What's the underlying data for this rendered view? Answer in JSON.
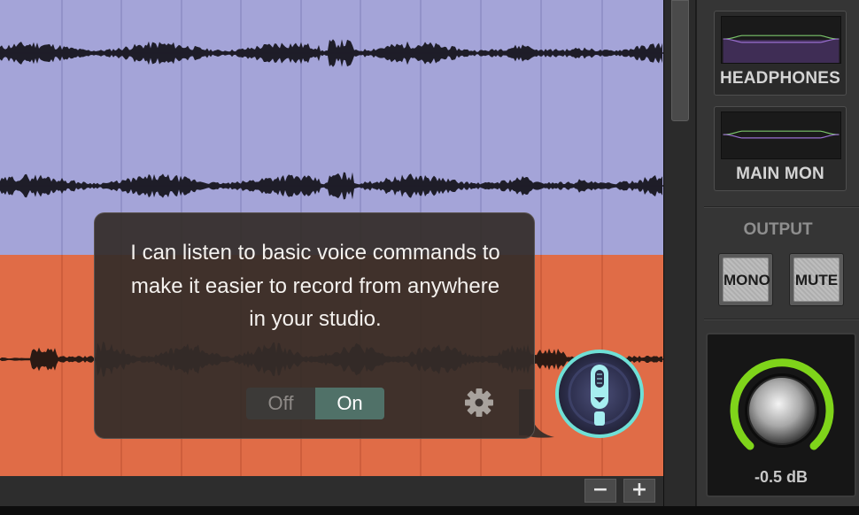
{
  "voice_tooltip": {
    "message": "I can listen to basic voice commands to make it easier to record from anywhere in your studio.",
    "toggle": {
      "off_label": "Off",
      "on_label": "On",
      "selected": "On"
    },
    "settings_icon": "gear-icon",
    "mic_icon": "microphone-icon"
  },
  "tracks": [
    {
      "color": "#a4a4d8"
    },
    {
      "color": "#e06c47"
    }
  ],
  "zoom_controls": {
    "zoom_out_label": "−",
    "zoom_in_label": "+",
    "zoom_fit_icon": "zoom-region-icon"
  },
  "monitor_outputs": [
    {
      "label": "HEADPHONES"
    },
    {
      "label": "MAIN MON"
    }
  ],
  "output_section": {
    "title": "OUTPUT",
    "mono_label": "MONO",
    "mute_label": "MUTE"
  },
  "volume_knob": {
    "value_text": "-0.5 dB",
    "ring_color": "#7fd41a"
  }
}
